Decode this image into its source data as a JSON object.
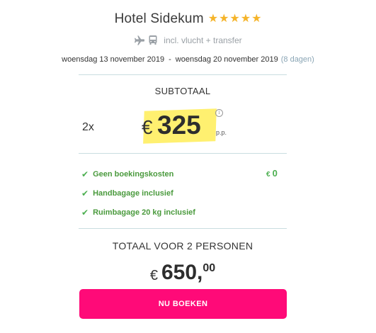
{
  "hotel": {
    "name": "Hotel Sidekum",
    "stars": [
      "★",
      "★",
      "★",
      "★",
      "★"
    ],
    "star_color": "#f5b42a"
  },
  "transport": {
    "icons": [
      "plane-icon",
      "bus-icon"
    ],
    "text": "incl. vlucht + transfer"
  },
  "dates": {
    "start": "woensdag 13 november 2019",
    "separator": "-",
    "end": "woensdag 20 november 2019",
    "duration": "(8 dagen)"
  },
  "subtotal": {
    "label": "SUBTOTAAL",
    "quantity": "2x",
    "currency": "€",
    "amount": "325",
    "per_person": "p.p.",
    "info_icon": "i",
    "highlight_color": "#fff070"
  },
  "features": [
    {
      "icon": "check-icon",
      "label": "Geen boekingskosten"
    },
    {
      "icon": "check-icon",
      "label": "Handbagage inclusief"
    },
    {
      "icon": "check-icon",
      "label": "Ruimbagage 20 kg inclusief"
    }
  ],
  "booking_fee": {
    "currency": "€",
    "amount": "0"
  },
  "total": {
    "label": "TOTAAL VOOR 2 PERSONEN",
    "currency": "€",
    "integer": "650,",
    "decimals": "00"
  },
  "book_button": {
    "label": "NU BOEKEN",
    "color": "#ff0a78"
  },
  "colors": {
    "accent": "#ff0a78",
    "success": "#4caf50",
    "divider": "#c9dde0"
  }
}
